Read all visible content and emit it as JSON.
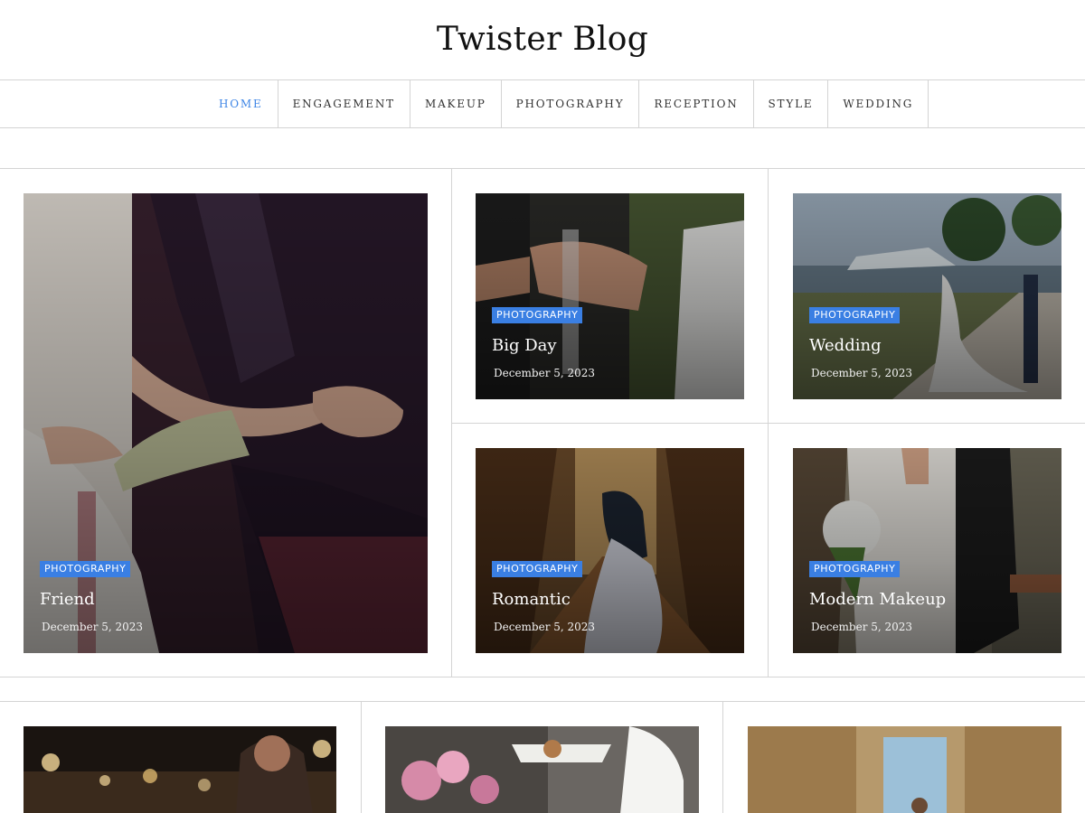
{
  "site": {
    "title": "Twister Blog"
  },
  "nav": {
    "items": [
      "HOME",
      "ENGAGEMENT",
      "MAKEUP",
      "PHOTOGRAPHY",
      "RECEPTION",
      "STYLE",
      "WEDDING"
    ]
  },
  "posts": [
    {
      "category": "PHOTOGRAPHY",
      "title": "Friend",
      "date": "December 5, 2023"
    },
    {
      "category": "PHOTOGRAPHY",
      "title": "Big Day",
      "date": "December 5, 2023"
    },
    {
      "category": "PHOTOGRAPHY",
      "title": "Wedding",
      "date": "December 5, 2023"
    },
    {
      "category": "PHOTOGRAPHY",
      "title": "Romantic",
      "date": "December 5, 2023"
    },
    {
      "category": "PHOTOGRAPHY",
      "title": "Modern Makeup",
      "date": "December 5, 2023"
    }
  ],
  "colors": {
    "accent": "#3a7fe3",
    "nav_active": "#3f86e6",
    "border": "#d4d4d4"
  }
}
